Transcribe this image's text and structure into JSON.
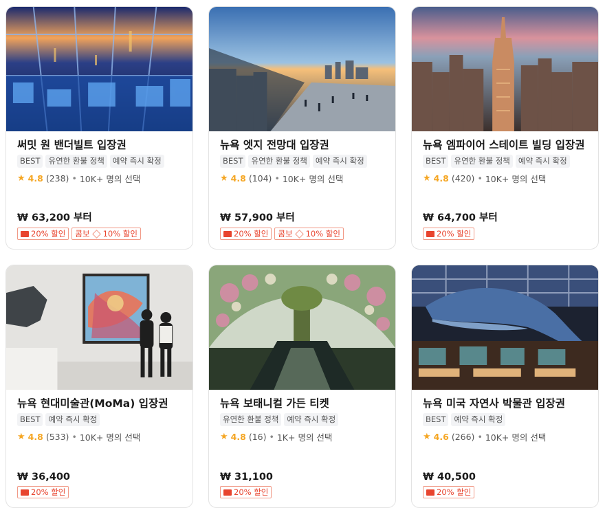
{
  "cards": [
    {
      "title": "써밋 원 밴더빌트 입장권",
      "tags": [
        "BEST",
        "유연한 환불 정책",
        "예약 즉시 확정"
      ],
      "rating": "4.8",
      "reviews": "(238)",
      "popularity": "10K+ 명의 선택",
      "price": "₩ 63,200 부터",
      "discount": "20% 할인",
      "combo": "콤보",
      "combo_discount": "10% 할인"
    },
    {
      "title": "뉴욕 엣지 전망대 입장권",
      "tags": [
        "BEST",
        "유연한 환불 정책",
        "예약 즉시 확정"
      ],
      "rating": "4.8",
      "reviews": "(104)",
      "popularity": "10K+ 명의 선택",
      "price": "₩ 57,900 부터",
      "discount": "20% 할인",
      "combo": "콤보",
      "combo_discount": "10% 할인"
    },
    {
      "title": "뉴욕 엠파이어 스테이트 빌딩 입장권",
      "tags": [
        "BEST",
        "유연한 환불 정책",
        "예약 즉시 확정"
      ],
      "rating": "4.8",
      "reviews": "(420)",
      "popularity": "10K+ 명의 선택",
      "price": "₩ 64,700 부터",
      "discount": "20% 할인"
    },
    {
      "title": "뉴욕 현대미술관(MoMa) 입장권",
      "tags": [
        "BEST",
        "예약 즉시 확정"
      ],
      "rating": "4.8",
      "reviews": "(533)",
      "popularity": "10K+ 명의 선택",
      "price": "₩ 36,400",
      "discount": "20% 할인"
    },
    {
      "title": "뉴욕 보태니컬 가든 티켓",
      "tags": [
        "유연한 환불 정책",
        "예약 즉시 확정"
      ],
      "rating": "4.8",
      "reviews": "(16)",
      "popularity": "1K+ 명의 선택",
      "price": "₩ 31,100",
      "discount": "20% 할인"
    },
    {
      "title": "뉴욕 미국 자연사 박물관 입장권",
      "tags": [
        "BEST",
        "예약 즉시 확정"
      ],
      "rating": "4.6",
      "reviews": "(266)",
      "popularity": "10K+ 명의 선택",
      "price": "₩ 40,500",
      "discount": "20% 할인"
    }
  ],
  "colors": {
    "star": "#f5a623",
    "discount": "#e8442e"
  },
  "icons": {
    "star": "star-icon",
    "coupon": "coupon-icon"
  }
}
